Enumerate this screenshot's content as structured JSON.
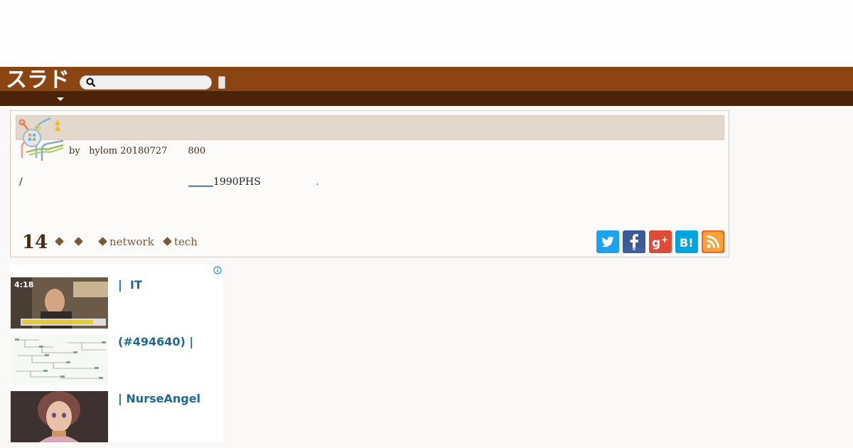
{
  "header": {
    "logo_text": "スラド",
    "search": {
      "placeholder": "",
      "value": ""
    }
  },
  "story": {
    "title": "",
    "byline": "by   hylom 20180727       800",
    "body_prefix": "/",
    "body_link_underline": "_____",
    "body_link_text": "1990PHS",
    "body_dot": ",",
    "comments_count": "14",
    "tags": [
      "",
      "",
      "network",
      "tech"
    ]
  },
  "share": {
    "twitter": "twitter-icon",
    "facebook": "facebook-icon",
    "googleplus": "google-plus-icon",
    "hatena": "hatena-bookmark-icon",
    "rss": "rss-icon"
  },
  "ad": {
    "items": [
      {
        "title": "|  IT",
        "thumb_text": "4:18"
      },
      {
        "title": "(#494640) |"
      },
      {
        "title": "| NurseAngel"
      }
    ]
  },
  "colors": {
    "header": "#8b4513",
    "subnav": "#4a2309",
    "title_bar": "#e2d8cb",
    "ad_title": "#1b6a98",
    "twitter": "#1da1f2",
    "facebook": "#3b5998",
    "googleplus": "#dd4b39",
    "hatena": "#00a4de",
    "rss": "#f26522"
  }
}
